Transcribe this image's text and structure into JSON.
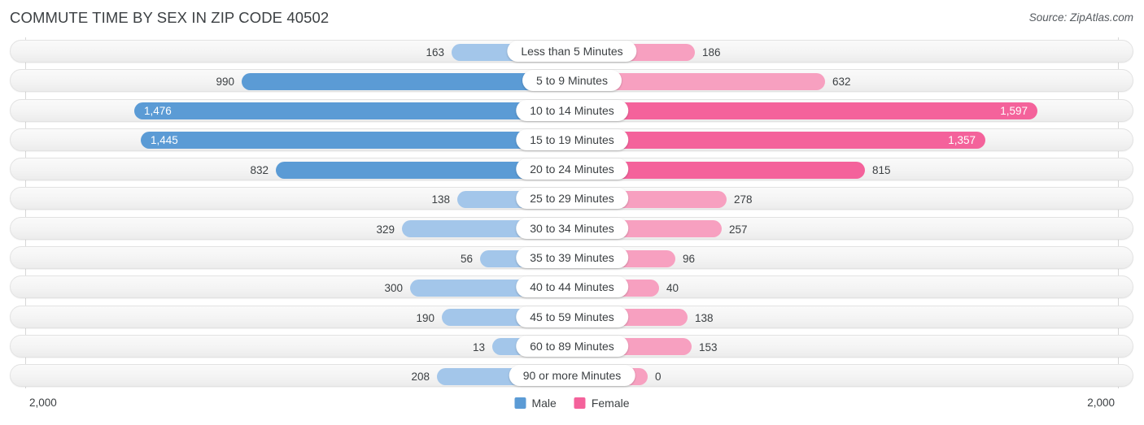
{
  "header": {
    "title": "COMMUTE TIME BY SEX IN ZIP CODE 40502",
    "source": "Source: ZipAtlas.com"
  },
  "axis": {
    "left_max_label": "2,000",
    "right_max_label": "2,000"
  },
  "legend": {
    "items": [
      {
        "label": "Male",
        "color": "#5b9bd5"
      },
      {
        "label": "Female",
        "color": "#f4629b"
      }
    ]
  },
  "colors": {
    "male_strong": "#5b9bd5",
    "male_light": "#a3c6ea",
    "female_strong": "#f4629b",
    "female_light": "#f7a0c0",
    "track_bg": "#f4f4f4",
    "track_border": "#e2e2e2"
  },
  "chart_data": {
    "type": "bar",
    "title": "COMMUTE TIME BY SEX IN ZIP CODE 40502",
    "orientation": "horizontal-diverging",
    "xlabel": "",
    "ylabel": "",
    "xlim": [
      2000,
      2000
    ],
    "grid": true,
    "legend_position": "bottom-center",
    "categories": [
      "Less than 5 Minutes",
      "5 to 9 Minutes",
      "10 to 14 Minutes",
      "15 to 19 Minutes",
      "20 to 24 Minutes",
      "25 to 29 Minutes",
      "30 to 34 Minutes",
      "35 to 39 Minutes",
      "40 to 44 Minutes",
      "45 to 59 Minutes",
      "60 to 89 Minutes",
      "90 or more Minutes"
    ],
    "series": [
      {
        "name": "Male",
        "values": [
          163,
          990,
          1476,
          1445,
          832,
          138,
          329,
          56,
          300,
          190,
          13,
          208
        ],
        "labels": [
          "163",
          "990",
          "1,476",
          "1,445",
          "832",
          "138",
          "329",
          "56",
          "300",
          "190",
          "13",
          "208"
        ]
      },
      {
        "name": "Female",
        "values": [
          186,
          632,
          1597,
          1357,
          815,
          278,
          257,
          96,
          40,
          138,
          153,
          0
        ],
        "labels": [
          "186",
          "632",
          "1,597",
          "1,357",
          "815",
          "278",
          "257",
          "96",
          "40",
          "138",
          "153",
          "0"
        ]
      }
    ]
  },
  "rows": [
    {
      "category": "Less than 5 Minutes",
      "male": "163",
      "female": "186",
      "male_w": 148,
      "female_w": 151,
      "male_inside": false,
      "female_inside": false,
      "male_strong": false,
      "female_strong": false
    },
    {
      "category": "5 to 9 Minutes",
      "male": "990",
      "female": "632",
      "male_w": 406,
      "female_w": 311,
      "male_inside": false,
      "female_inside": false,
      "male_strong": true,
      "female_strong": false
    },
    {
      "category": "10 to 14 Minutes",
      "male": "1,476",
      "female": "1,597",
      "male_w": 538,
      "female_w": 572,
      "male_inside": true,
      "female_inside": true,
      "male_strong": true,
      "female_strong": true
    },
    {
      "category": "15 to 19 Minutes",
      "male": "1,445",
      "female": "1,357",
      "male_w": 530,
      "female_w": 508,
      "male_inside": true,
      "female_inside": true,
      "male_strong": true,
      "female_strong": true
    },
    {
      "category": "20 to 24 Minutes",
      "male": "832",
      "female": "815",
      "male_w": 364,
      "female_w": 360,
      "male_inside": false,
      "female_inside": false,
      "male_strong": true,
      "female_strong": true
    },
    {
      "category": "25 to 29 Minutes",
      "male": "138",
      "female": "278",
      "male_w": 141,
      "female_w": 190,
      "male_inside": false,
      "female_inside": false,
      "male_strong": false,
      "female_strong": false
    },
    {
      "category": "30 to 34 Minutes",
      "male": "329",
      "female": "257",
      "male_w": 209,
      "female_w": 184,
      "male_inside": false,
      "female_inside": false,
      "male_strong": false,
      "female_strong": false
    },
    {
      "category": "35 to 39 Minutes",
      "male": "56",
      "female": "96",
      "male_w": 113,
      "female_w": 127,
      "male_inside": false,
      "female_inside": false,
      "male_strong": false,
      "female_strong": false
    },
    {
      "category": "40 to 44 Minutes",
      "male": "300",
      "female": "40",
      "male_w": 199,
      "female_w": 107,
      "male_inside": false,
      "female_inside": false,
      "male_strong": false,
      "female_strong": false
    },
    {
      "category": "45 to 59 Minutes",
      "male": "190",
      "female": "138",
      "male_w": 160,
      "female_w": 142,
      "male_inside": false,
      "female_inside": false,
      "male_strong": false,
      "female_strong": false
    },
    {
      "category": "60 to 89 Minutes",
      "male": "13",
      "female": "153",
      "male_w": 98,
      "female_w": 147,
      "male_inside": false,
      "female_inside": false,
      "male_strong": false,
      "female_strong": false
    },
    {
      "category": "90 or more Minutes",
      "male": "208",
      "female": "0",
      "male_w": 166,
      "female_w": 93,
      "male_inside": false,
      "female_inside": false,
      "male_strong": false,
      "female_strong": false
    }
  ]
}
